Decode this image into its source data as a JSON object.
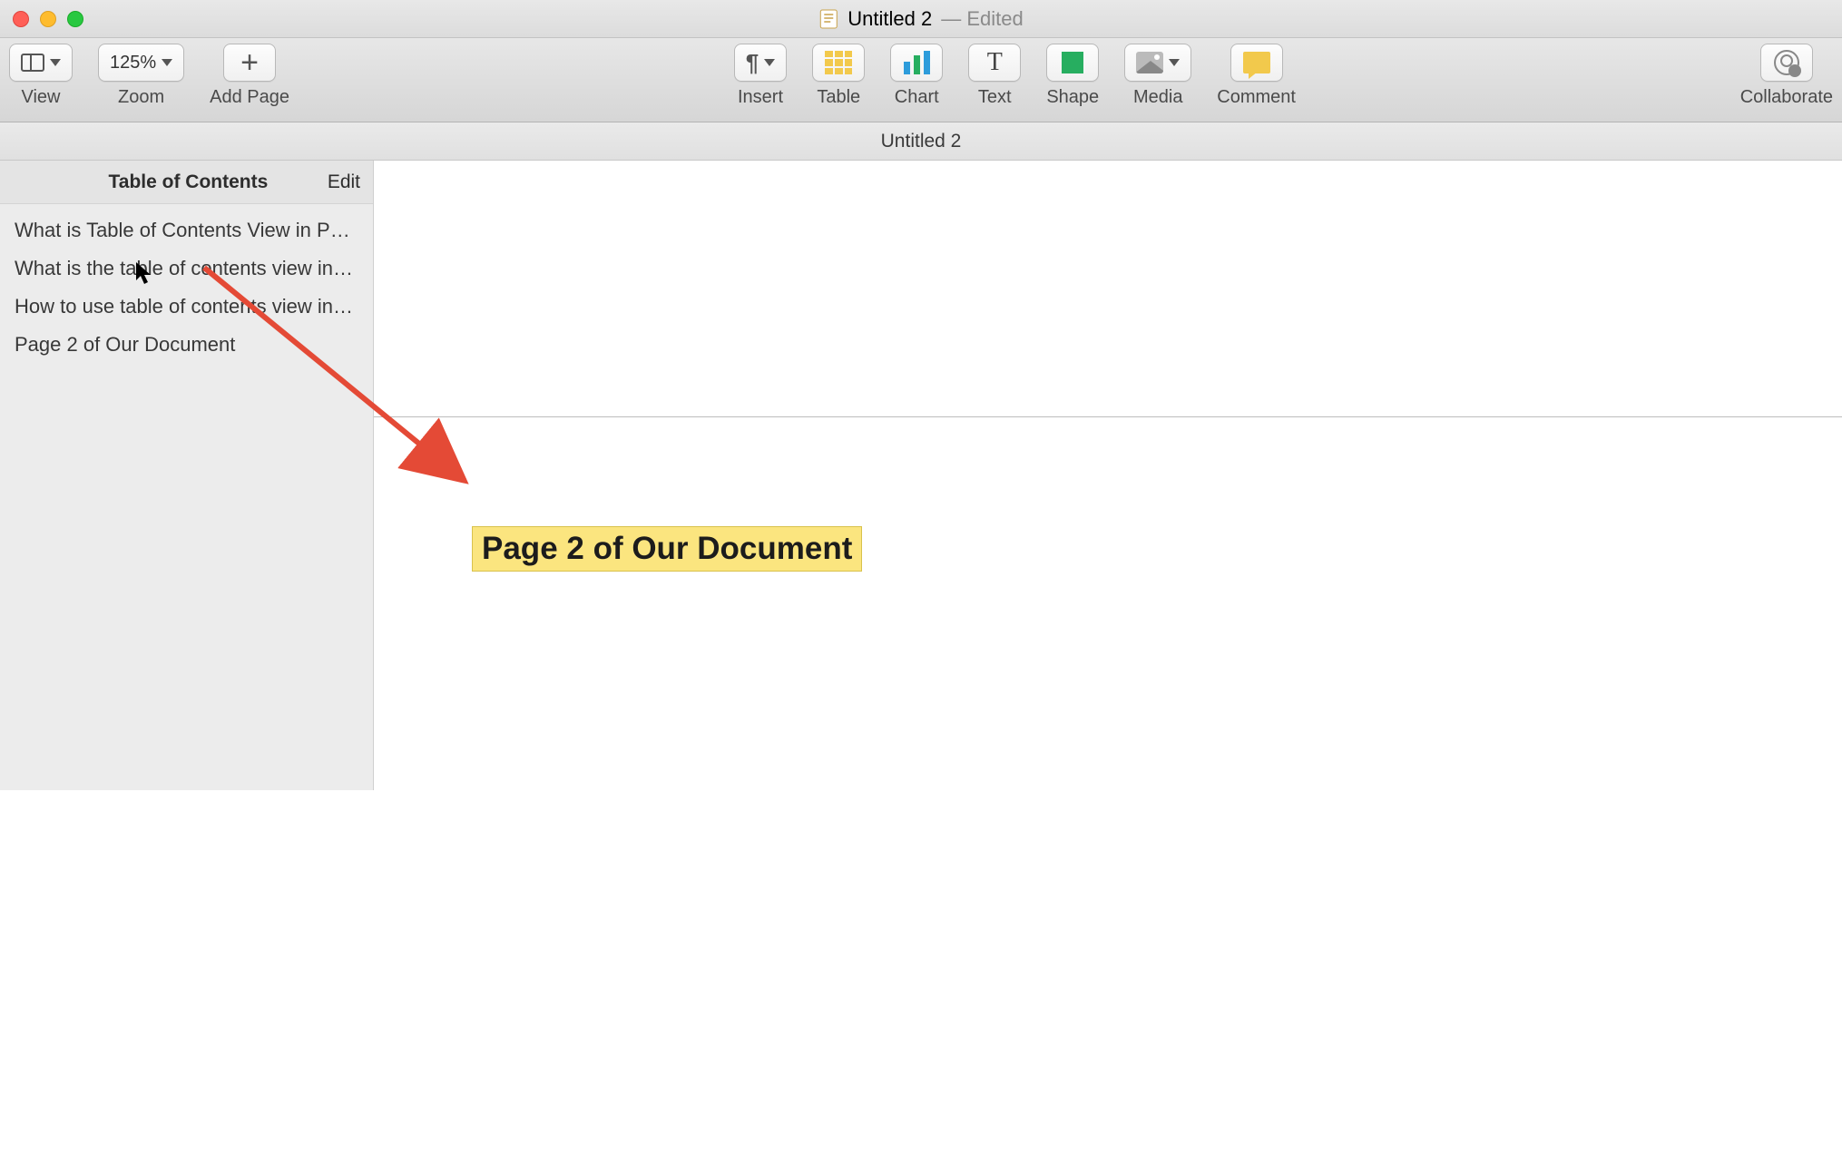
{
  "titlebar": {
    "doc_name": "Untitled 2",
    "edited_suffix": "— Edited"
  },
  "toolbar": {
    "view_label": "View",
    "zoom_value": "125%",
    "zoom_label": "Zoom",
    "add_page_label": "Add Page",
    "insert_label": "Insert",
    "table_label": "Table",
    "chart_label": "Chart",
    "text_label": "Text",
    "shape_label": "Shape",
    "media_label": "Media",
    "comment_label": "Comment",
    "collaborate_label": "Collaborate"
  },
  "docname_bar": "Untitled 2",
  "sidebar": {
    "title": "Table of Contents",
    "edit_label": "Edit",
    "items": [
      "What is Table of Contents View in Pages an…",
      "What is the table of contents view in Pages?",
      "How to use table of contents view in Pages",
      "Page 2 of Our Document"
    ]
  },
  "document": {
    "highlighted_heading": "Page 2 of Our Document"
  },
  "annotation": {
    "arrow_color": "#e44a36"
  }
}
